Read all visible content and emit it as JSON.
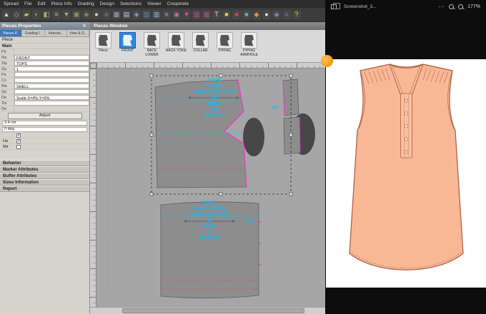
{
  "menu": {
    "items": [
      "Spread",
      "File",
      "Edit",
      "Piece Info",
      "Grading",
      "Design",
      "Selections",
      "Viewer",
      "Cooperate"
    ]
  },
  "toolbar": {
    "icons": [
      {
        "name": "select-tool-icon",
        "glyph": "▲",
        "color": "#d2dbc8"
      },
      {
        "name": "lasso-tool-icon",
        "glyph": "◇",
        "color": "#a8c47e"
      },
      {
        "name": "piece-tool-icon",
        "glyph": "▰",
        "color": "#c9b94f"
      },
      {
        "name": "rotate-tool-icon",
        "glyph": "◐",
        "color": "#8db069"
      },
      {
        "name": "flip-tool-icon",
        "glyph": "◧",
        "color": "#9dbb72"
      },
      {
        "name": "ruler-tool-icon",
        "glyph": "≡",
        "color": "#c9bb55"
      },
      {
        "name": "notch-tool-icon",
        "glyph": "▼",
        "color": "#a9b271"
      },
      {
        "name": "grade-tool-icon",
        "glyph": "▣",
        "color": "#7ba455"
      },
      {
        "name": "seam-tool-icon",
        "glyph": "◆",
        "color": "#5e9747"
      },
      {
        "name": "zoom-tool-icon",
        "glyph": "●",
        "color": "#d5dade"
      },
      {
        "name": "pan-tool-icon",
        "glyph": "○",
        "color": "#ccd2d8"
      },
      {
        "name": "grid-tool-icon",
        "glyph": "▦",
        "color": "#93a9c4"
      },
      {
        "name": "guides-tool-icon",
        "glyph": "▤",
        "color": "#c4cbd4"
      },
      {
        "name": "snap-tool-icon",
        "glyph": "◈",
        "color": "#7fa9d6"
      },
      {
        "name": "layers-tool-icon",
        "glyph": "▧",
        "color": "#6189c2"
      },
      {
        "name": "table-tool-icon",
        "glyph": "▥",
        "color": "#a2bcda"
      },
      {
        "name": "point-tool-icon",
        "glyph": "■",
        "color": "#4e7fbf"
      },
      {
        "name": "curve-tool-icon",
        "glyph": "◉",
        "color": "#d06aae"
      },
      {
        "name": "dart-tool-icon",
        "glyph": "▼",
        "color": "#de4f9e"
      },
      {
        "name": "pleat-tool-icon",
        "glyph": "▨",
        "color": "#c84a92"
      },
      {
        "name": "plot-tool-icon",
        "glyph": "▩",
        "color": "#b04a86"
      },
      {
        "name": "text-tool-icon",
        "glyph": "T",
        "color": "#d8d8d8"
      },
      {
        "name": "color-tool-icon",
        "glyph": "■",
        "color": "#e6c631"
      },
      {
        "name": "fill-tool-icon",
        "glyph": "■",
        "color": "#d84444"
      },
      {
        "name": "swatch-tool-icon",
        "glyph": "■",
        "color": "#45b5d6"
      },
      {
        "name": "render-tool-icon",
        "glyph": "◆",
        "color": "#ef9133"
      },
      {
        "name": "camera-tool-icon",
        "glyph": "●",
        "color": "#e3e3e3"
      },
      {
        "name": "view-3d-tool-icon",
        "glyph": "◆",
        "color": "#8e6fd0"
      },
      {
        "name": "sync-tool-icon",
        "glyph": "○",
        "color": "#6fd0a8"
      },
      {
        "name": "help-tool-icon",
        "glyph": "?",
        "color": "#e8e23c"
      }
    ]
  },
  "left_panel": {
    "title": "Pieces Properties",
    "close_glyph": "✕",
    "tabs": [
      {
        "label": "Pieces P..",
        "selected": true
      },
      {
        "label": "Grading I..",
        "selected": false
      },
      {
        "label": "Internal..",
        "selected": false
      },
      {
        "label": "View & S..",
        "selected": false
      }
    ],
    "piece_label": "Piece",
    "section_main": "Main",
    "fields": [
      {
        "label": "Ph",
        "value": "",
        "input": false
      },
      {
        "label": "Na",
        "value": "FRONT",
        "input": true
      },
      {
        "label": "Sty",
        "value": "TOPS",
        "input": true
      },
      {
        "label": "Qu",
        "value": "1",
        "input": true
      },
      {
        "label": "Pa",
        "value": "",
        "input": true
      },
      {
        "label": "Co",
        "value": "",
        "input": true
      },
      {
        "label": "Ma",
        "value": "SHELL",
        "input": true
      },
      {
        "label": "Qu",
        "value": "",
        "input": true
      },
      {
        "label": "De",
        "value": "Scale X=4%,Y=6%",
        "input": true
      },
      {
        "label": "Tin",
        "value": "",
        "input": true
      },
      {
        "label": "De",
        "value": "",
        "input": false
      }
    ],
    "adjust_button": "Adjust",
    "measure_value": "3.4 cm",
    "angle_value": "0 deg",
    "checkboxes": [
      {
        "label": "",
        "checked": true
      },
      {
        "label": "Ha",
        "checked": true
      },
      {
        "label": "Mir",
        "checked": false
      }
    ],
    "sections": [
      "Behavior",
      "Marker Attributes",
      "Buffer Attributes",
      "Sizes Information",
      "Report"
    ]
  },
  "pieces_window": {
    "title": "Pieces Window",
    "thumbnails": [
      {
        "label": "Piece",
        "selected": false
      },
      {
        "label": "FRONT",
        "selected": true
      },
      {
        "label": "BACK LOWER",
        "selected": false
      },
      {
        "label": "BACK YOKE",
        "selected": false
      },
      {
        "label": "COLLAR",
        "selected": false
      },
      {
        "label": "PIPING",
        "selected": false
      },
      {
        "label": "PIPING ARMHOLE",
        "selected": false
      }
    ],
    "front_annotation": [
      "TOPS",
      "FRONT",
      "Scale X=4%, Y=6%",
      "48",
      "SHELL",
      "(1)",
      "3D-Front"
    ],
    "back_annotation": [
      "TOPS",
      "BACK LOWER",
      "Scale X=4%,Y=6%",
      "48",
      "SHELL",
      "(1)",
      "3D-Front"
    ],
    "front_code": "B51",
    "back_code": "B51"
  },
  "viewer": {
    "filename": "Screenshot_3...",
    "zoom": "177%"
  },
  "colors": {
    "accent_blue": "#2f86e0",
    "annotation_cyan": "#00c3ff",
    "seam_magenta": "#ff2fd0",
    "garment_peach": "#f8b795"
  }
}
